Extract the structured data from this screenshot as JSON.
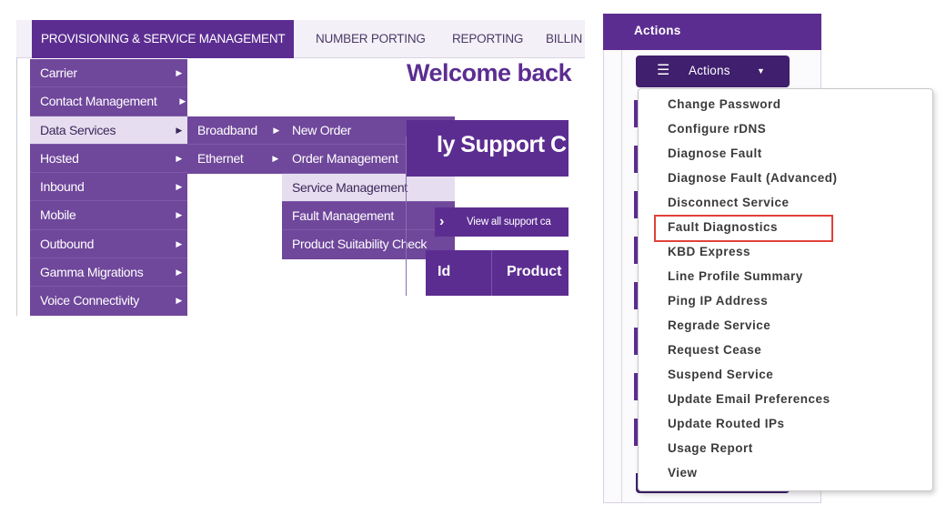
{
  "left": {
    "top_nav": {
      "tabs": [
        {
          "label": "PROVISIONING & SERVICE MANAGEMENT"
        },
        {
          "label": "NUMBER PORTING"
        },
        {
          "label": "REPORTING"
        },
        {
          "label": "BILLIN"
        }
      ]
    },
    "main_menu": [
      {
        "label": "Carrier"
      },
      {
        "label": "Contact Management"
      },
      {
        "label": "Data Services"
      },
      {
        "label": "Hosted"
      },
      {
        "label": "Inbound"
      },
      {
        "label": "Mobile"
      },
      {
        "label": "Outbound"
      },
      {
        "label": "Gamma Migrations"
      },
      {
        "label": "Voice Connectivity"
      }
    ],
    "sub_menu": [
      {
        "label": "Broadband"
      },
      {
        "label": "Ethernet"
      }
    ],
    "broadband_menu": [
      {
        "label": "New Order"
      },
      {
        "label": "Order Management"
      },
      {
        "label": "Service Management"
      },
      {
        "label": "Fault Management"
      },
      {
        "label": "Product Suitability Check"
      }
    ],
    "welcome": "Welcome back",
    "support_title": "ly Support C",
    "view_all": "View all support ca",
    "table": {
      "col_id": "Id",
      "col_product": "Product"
    }
  },
  "right": {
    "panel_header": "Actions",
    "actions_button": {
      "label": "Actions",
      "icon": "hamburger-icon",
      "caret": "caret-down-icon"
    },
    "dropdown_items": [
      {
        "label": "Change Password"
      },
      {
        "label": "Configure rDNS"
      },
      {
        "label": "Diagnose Fault"
      },
      {
        "label": "Diagnose Fault (Advanced)"
      },
      {
        "label": "Disconnect Service"
      },
      {
        "label": "Fault Diagnostics",
        "highlighted": true
      },
      {
        "label": "KBD Express"
      },
      {
        "label": "Line Profile Summary"
      },
      {
        "label": "Ping IP Address"
      },
      {
        "label": "Regrade Service"
      },
      {
        "label": "Request Cease"
      },
      {
        "label": "Suspend Service"
      },
      {
        "label": "Update Email Preferences"
      },
      {
        "label": "Update Routed IPs"
      },
      {
        "label": "Usage Report"
      },
      {
        "label": "View"
      }
    ],
    "highlight_color": "#e0413a"
  },
  "colors": {
    "brand_purple": "#5c2d91",
    "menu_purple": "#6f479b",
    "menu_highlight": "#e6def0"
  }
}
